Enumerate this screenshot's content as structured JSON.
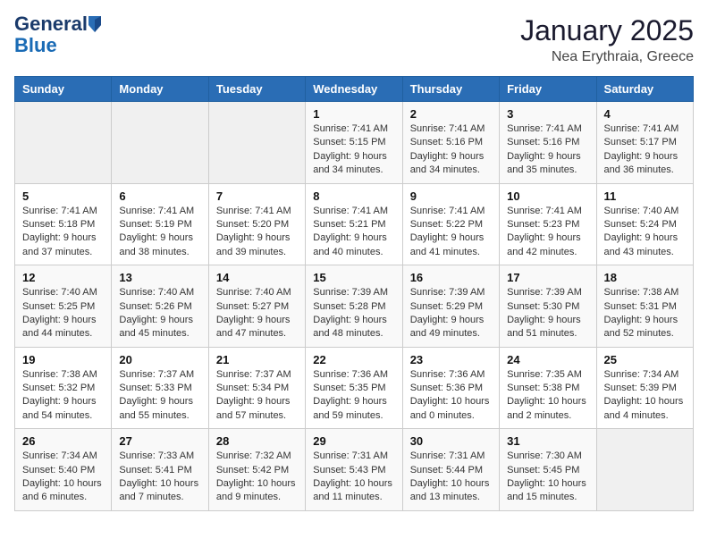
{
  "header": {
    "logo": {
      "general": "General",
      "blue": "Blue"
    },
    "title": "January 2025",
    "location": "Nea Erythraia, Greece"
  },
  "days_of_week": [
    "Sunday",
    "Monday",
    "Tuesday",
    "Wednesday",
    "Thursday",
    "Friday",
    "Saturday"
  ],
  "weeks": [
    [
      {
        "day": null,
        "data": null
      },
      {
        "day": null,
        "data": null
      },
      {
        "day": null,
        "data": null
      },
      {
        "day": "1",
        "sunrise": "7:41 AM",
        "sunset": "5:15 PM",
        "daylight": "9 hours and 34 minutes."
      },
      {
        "day": "2",
        "sunrise": "7:41 AM",
        "sunset": "5:16 PM",
        "daylight": "9 hours and 34 minutes."
      },
      {
        "day": "3",
        "sunrise": "7:41 AM",
        "sunset": "5:16 PM",
        "daylight": "9 hours and 35 minutes."
      },
      {
        "day": "4",
        "sunrise": "7:41 AM",
        "sunset": "5:17 PM",
        "daylight": "9 hours and 36 minutes."
      }
    ],
    [
      {
        "day": "5",
        "sunrise": "7:41 AM",
        "sunset": "5:18 PM",
        "daylight": "9 hours and 37 minutes."
      },
      {
        "day": "6",
        "sunrise": "7:41 AM",
        "sunset": "5:19 PM",
        "daylight": "9 hours and 38 minutes."
      },
      {
        "day": "7",
        "sunrise": "7:41 AM",
        "sunset": "5:20 PM",
        "daylight": "9 hours and 39 minutes."
      },
      {
        "day": "8",
        "sunrise": "7:41 AM",
        "sunset": "5:21 PM",
        "daylight": "9 hours and 40 minutes."
      },
      {
        "day": "9",
        "sunrise": "7:41 AM",
        "sunset": "5:22 PM",
        "daylight": "9 hours and 41 minutes."
      },
      {
        "day": "10",
        "sunrise": "7:41 AM",
        "sunset": "5:23 PM",
        "daylight": "9 hours and 42 minutes."
      },
      {
        "day": "11",
        "sunrise": "7:40 AM",
        "sunset": "5:24 PM",
        "daylight": "9 hours and 43 minutes."
      }
    ],
    [
      {
        "day": "12",
        "sunrise": "7:40 AM",
        "sunset": "5:25 PM",
        "daylight": "9 hours and 44 minutes."
      },
      {
        "day": "13",
        "sunrise": "7:40 AM",
        "sunset": "5:26 PM",
        "daylight": "9 hours and 45 minutes."
      },
      {
        "day": "14",
        "sunrise": "7:40 AM",
        "sunset": "5:27 PM",
        "daylight": "9 hours and 47 minutes."
      },
      {
        "day": "15",
        "sunrise": "7:39 AM",
        "sunset": "5:28 PM",
        "daylight": "9 hours and 48 minutes."
      },
      {
        "day": "16",
        "sunrise": "7:39 AM",
        "sunset": "5:29 PM",
        "daylight": "9 hours and 49 minutes."
      },
      {
        "day": "17",
        "sunrise": "7:39 AM",
        "sunset": "5:30 PM",
        "daylight": "9 hours and 51 minutes."
      },
      {
        "day": "18",
        "sunrise": "7:38 AM",
        "sunset": "5:31 PM",
        "daylight": "9 hours and 52 minutes."
      }
    ],
    [
      {
        "day": "19",
        "sunrise": "7:38 AM",
        "sunset": "5:32 PM",
        "daylight": "9 hours and 54 minutes."
      },
      {
        "day": "20",
        "sunrise": "7:37 AM",
        "sunset": "5:33 PM",
        "daylight": "9 hours and 55 minutes."
      },
      {
        "day": "21",
        "sunrise": "7:37 AM",
        "sunset": "5:34 PM",
        "daylight": "9 hours and 57 minutes."
      },
      {
        "day": "22",
        "sunrise": "7:36 AM",
        "sunset": "5:35 PM",
        "daylight": "9 hours and 59 minutes."
      },
      {
        "day": "23",
        "sunrise": "7:36 AM",
        "sunset": "5:36 PM",
        "daylight": "10 hours and 0 minutes."
      },
      {
        "day": "24",
        "sunrise": "7:35 AM",
        "sunset": "5:38 PM",
        "daylight": "10 hours and 2 minutes."
      },
      {
        "day": "25",
        "sunrise": "7:34 AM",
        "sunset": "5:39 PM",
        "daylight": "10 hours and 4 minutes."
      }
    ],
    [
      {
        "day": "26",
        "sunrise": "7:34 AM",
        "sunset": "5:40 PM",
        "daylight": "10 hours and 6 minutes."
      },
      {
        "day": "27",
        "sunrise": "7:33 AM",
        "sunset": "5:41 PM",
        "daylight": "10 hours and 7 minutes."
      },
      {
        "day": "28",
        "sunrise": "7:32 AM",
        "sunset": "5:42 PM",
        "daylight": "10 hours and 9 minutes."
      },
      {
        "day": "29",
        "sunrise": "7:31 AM",
        "sunset": "5:43 PM",
        "daylight": "10 hours and 11 minutes."
      },
      {
        "day": "30",
        "sunrise": "7:31 AM",
        "sunset": "5:44 PM",
        "daylight": "10 hours and 13 minutes."
      },
      {
        "day": "31",
        "sunrise": "7:30 AM",
        "sunset": "5:45 PM",
        "daylight": "10 hours and 15 minutes."
      },
      {
        "day": null,
        "data": null
      }
    ]
  ]
}
